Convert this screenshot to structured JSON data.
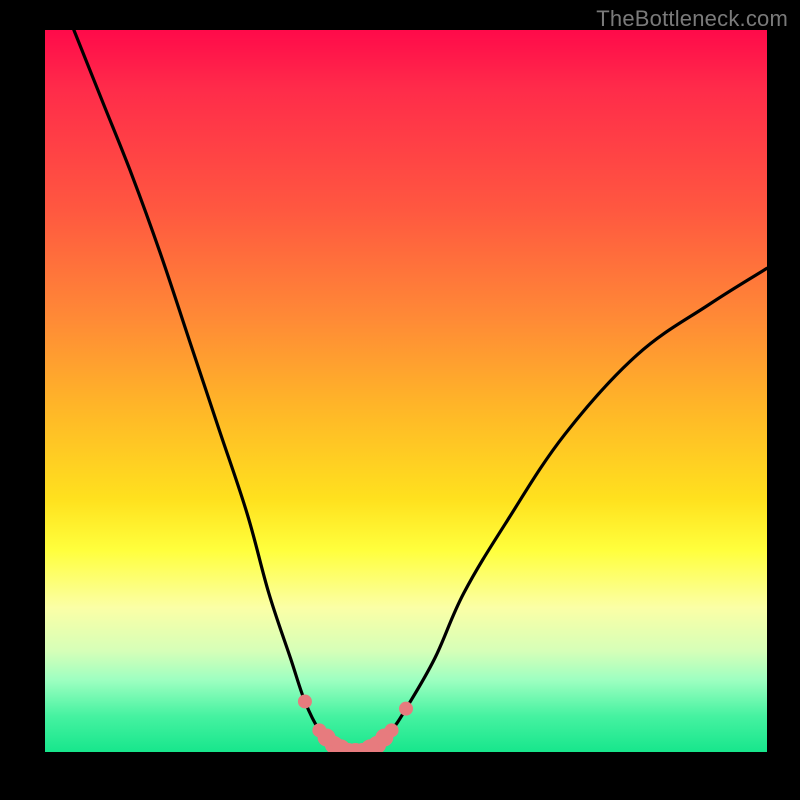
{
  "watermark": "TheBottleneck.com",
  "chart_data": {
    "type": "line",
    "title": "",
    "xlabel": "",
    "ylabel": "",
    "xlim": [
      0,
      100
    ],
    "ylim": [
      0,
      100
    ],
    "series": [
      {
        "name": "bottleneck-curve",
        "x": [
          4,
          8,
          12,
          16,
          20,
          24,
          28,
          31,
          34,
          36,
          38,
          40,
          42,
          44,
          46,
          48,
          50,
          54,
          58,
          64,
          72,
          82,
          92,
          100
        ],
        "y": [
          100,
          90,
          80,
          69,
          57,
          45,
          33,
          22,
          13,
          7,
          3,
          1,
          0,
          0,
          1,
          3,
          6,
          13,
          22,
          32,
          44,
          55,
          62,
          67
        ]
      }
    ],
    "markers": {
      "name": "highlight-dots",
      "x_range": [
        35,
        50
      ],
      "color": "#e77b7e"
    },
    "gradient_stops": [
      {
        "pos": 0.0,
        "color": "#ff0a4a"
      },
      {
        "pos": 0.25,
        "color": "#ff5840"
      },
      {
        "pos": 0.52,
        "color": "#ffb528"
      },
      {
        "pos": 0.72,
        "color": "#ffff3c"
      },
      {
        "pos": 0.9,
        "color": "#9effc1"
      },
      {
        "pos": 1.0,
        "color": "#17e68c"
      }
    ]
  }
}
